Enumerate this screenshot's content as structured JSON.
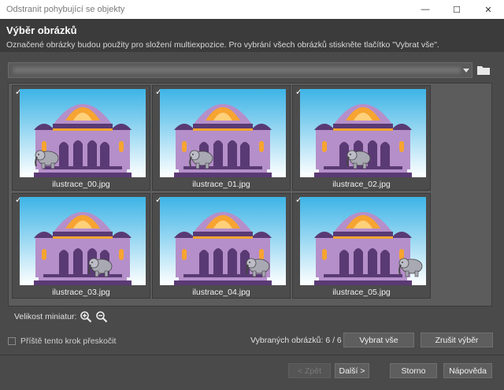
{
  "window": {
    "title": "Odstranit pohybující se objekty",
    "minimize_glyph": "—",
    "maximize_glyph": "☐",
    "close_glyph": "✕"
  },
  "header": {
    "title": "Výběr obrázků",
    "description": "Označené obrázky budou použity pro složení multiexpozice. Pro vybrání všech obrázků stiskněte tlačítko \"Vybrat vše\"."
  },
  "path": {
    "icon": "folder-icon"
  },
  "images": [
    {
      "filename": "ilustrace_00.jpg",
      "checked": true,
      "check_glyph": "✓"
    },
    {
      "filename": "ilustrace_01.jpg",
      "checked": true,
      "check_glyph": "✓"
    },
    {
      "filename": "ilustrace_02.jpg",
      "checked": true,
      "check_glyph": "✓"
    },
    {
      "filename": "ilustrace_03.jpg",
      "checked": true,
      "check_glyph": "✓"
    },
    {
      "filename": "ilustrace_04.jpg",
      "checked": true,
      "check_glyph": "✓"
    },
    {
      "filename": "ilustrace_05.jpg",
      "checked": true,
      "check_glyph": "✓"
    }
  ],
  "thumbnail_size": {
    "label": "Velikost miniatur:",
    "zoom_in_icon": "zoom-in-icon",
    "zoom_out_icon": "zoom-out-icon"
  },
  "skip_step": {
    "label": "Příště tento krok přeskočit",
    "checked": false
  },
  "selection": {
    "count_text": "Vybraných obrázků: 6 / 6",
    "select_all_label": "Vybrat vše",
    "clear_label": "Zrušit výběr"
  },
  "footer": {
    "back_label": "< Zpět",
    "next_label": "Další >",
    "cancel_label": "Storno",
    "help_label": "Nápověda"
  },
  "colors": {
    "background": "#4a4a4a",
    "header_bg": "#3b3b3b",
    "sky_top": "#3db4e6",
    "sky_bottom": "#ffffff",
    "palace": "#b58fc9",
    "palace_dark": "#5a3a74",
    "dome_accent": "#f7a431"
  }
}
